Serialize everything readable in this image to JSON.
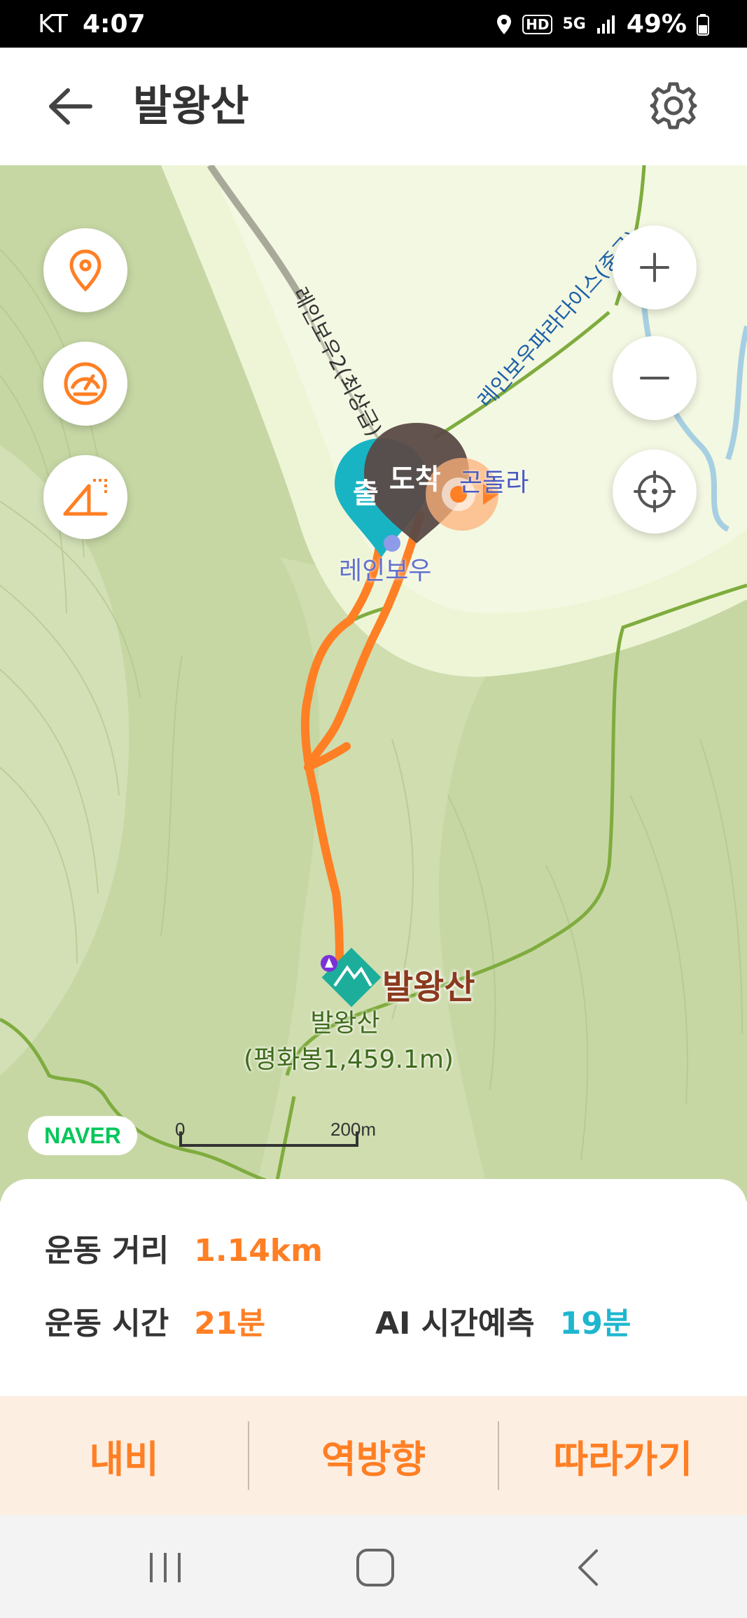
{
  "status_bar": {
    "carrier": "KT",
    "time": "4:07",
    "network": "5G",
    "hd": "HD",
    "battery": "49%"
  },
  "header": {
    "title": "발왕산",
    "back_icon": "arrow-left-icon",
    "settings_icon": "gear-icon"
  },
  "map": {
    "road_label_1": "레인보우2(최상급)",
    "road_label_2": "레인보우파라다이스(중급)",
    "gondola_label": "곤돌라",
    "station_label": "레인보우",
    "start_marker": "출",
    "end_marker": "도착",
    "summit_label": "발왕산",
    "peak_name": "발왕산",
    "peak_detail": "(평화봉1,459.1m)",
    "map_provider": "NAVER",
    "scale_start": "0",
    "scale_end": "200m",
    "route_color": "#ff7f24",
    "left_controls": [
      "location-pin-icon",
      "speedometer-icon",
      "slope-icon"
    ],
    "right_controls": [
      "zoom-in-icon",
      "zoom-out-icon",
      "crosshair-icon"
    ]
  },
  "stats": {
    "distance_label": "운동 거리",
    "distance_value": "1.14km",
    "time_label": "운동 시간",
    "time_value": "21분",
    "ai_label": "AI 시간예측",
    "ai_value": "19분"
  },
  "actions": {
    "navi": "내비",
    "reverse": "역방향",
    "follow": "따라가기"
  },
  "colors": {
    "accent": "#ff7f24",
    "ai_accent": "#1eb6cf",
    "action_bg": "#fdeee2"
  }
}
